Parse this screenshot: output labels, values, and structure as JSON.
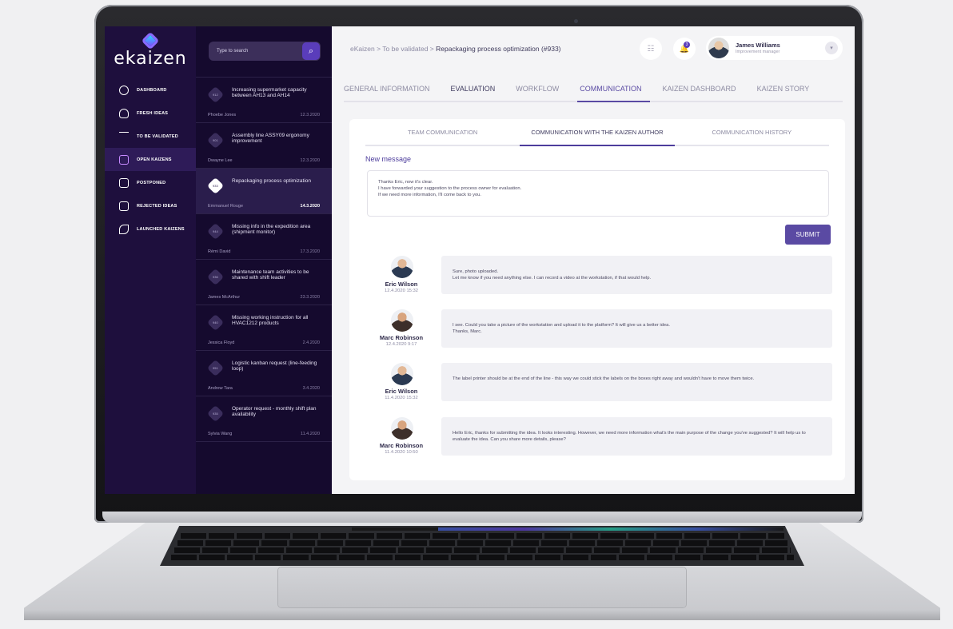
{
  "logo": "ekaizen",
  "nav": [
    {
      "label": "DASHBOARD",
      "icon": "dashboard-icon"
    },
    {
      "label": "FRESH IDEAS",
      "icon": "bulb-icon"
    },
    {
      "label": "TO BE VALIDATED",
      "icon": "scale-icon"
    },
    {
      "label": "OPEN KAIZENS",
      "icon": "clipboard-icon"
    },
    {
      "label": "POSTPONED",
      "icon": "postpone-icon"
    },
    {
      "label": "REJECTED IDEAS",
      "icon": "reject-icon"
    },
    {
      "label": "LAUNCHED KAIZENS",
      "icon": "rocket-icon"
    }
  ],
  "search": {
    "placeholder": "Type to search",
    "icon": "search-icon"
  },
  "ideas": [
    {
      "num": "912",
      "title": "Increasing supermarket capacity between AH13 and AH14",
      "author": "Phoebe Jones",
      "date": "12.3.2020"
    },
    {
      "num": "901",
      "title": "Assembly line ASSY09 ergonomy improvement",
      "author": "Dwayne Lee",
      "date": "12.3.2020"
    },
    {
      "num": "933",
      "title": "Repackaging process optimization",
      "author": "Emmanuel Rouge",
      "date": "14.3.2020"
    },
    {
      "num": "944",
      "title": "Missing info in the expedition area (shipment monitor)",
      "author": "Rémi David",
      "date": "17.3.2020"
    },
    {
      "num": "936",
      "title": "Maintenance team activities to be shared with shift leader",
      "author": "James McArthur",
      "date": "23.3.2020"
    },
    {
      "num": "940",
      "title": "Missing working instruction for all HVAC1212 products",
      "author": "Jessica Floyd",
      "date": "2.4.2020"
    },
    {
      "num": "951",
      "title": "Logistic kanban request (line-feeding loop)",
      "author": "Andrew Tara",
      "date": "3.4.2020"
    },
    {
      "num": "935",
      "title": "Operator request - monthly shift plan availability",
      "author": "Sylvia Wang",
      "date": "11.4.2020"
    }
  ],
  "breadcrumb": {
    "prefix": "eKaizen > To be validated > ",
    "current": "Repackaging process optimization (#933)"
  },
  "notifications": {
    "count": "3"
  },
  "user": {
    "name": "James Williams",
    "role": "Improvement manager"
  },
  "tabs": [
    "GENERAL INFORMATION",
    "EVALUATION",
    "WORKFLOW",
    "COMMUNICATION",
    "KAIZEN DASHBOARD",
    "KAIZEN STORY"
  ],
  "subtabs": [
    "TEAM COMMUNICATION",
    "COMMUNICATION WITH THE KAIZEN AUTHOR",
    "COMMUNICATION HISTORY"
  ],
  "new_message_label": "New message",
  "draft": "Thanks Eric, now it's clear.\nI have forwarded your suggestion to the process owner for evaluation.\nIf we need more information, I'll come back to you.",
  "submit_label": "SUBMIT",
  "messages": [
    {
      "name": "Eric Wilson",
      "time": "12.4.2020 15:32",
      "text": "Sure, photo uploaded.\nLet me know if you need anything else. I can record a video at the workstation, if that would help."
    },
    {
      "name": "Marc Robinson",
      "time": "12.4.2020 9:17",
      "text": "I see. Could you take a picture of the workstation and upload it to the platform? It will give us a better idea.\nThanks, Marc."
    },
    {
      "name": "Eric Wilson",
      "time": "11.4.2020 15:32",
      "text": "The label printer should be at the end of the line - this way we could stick the labels on the boxes right away and wouldn't have to move them twice."
    },
    {
      "name": "Marc Robinson",
      "time": "11.4.2020 10:50",
      "text": "Hello Eric, thanks for submitting the idea. It looks interesting. However, we need more information what's the main purpose of the change you've suggested?  It will help us to evaluate the idea. Can you share more details, please?"
    }
  ],
  "colors": {
    "accent": "#5a4aa3",
    "nav_bg": "#1e0f3d",
    "list_bg": "#150a2e"
  }
}
